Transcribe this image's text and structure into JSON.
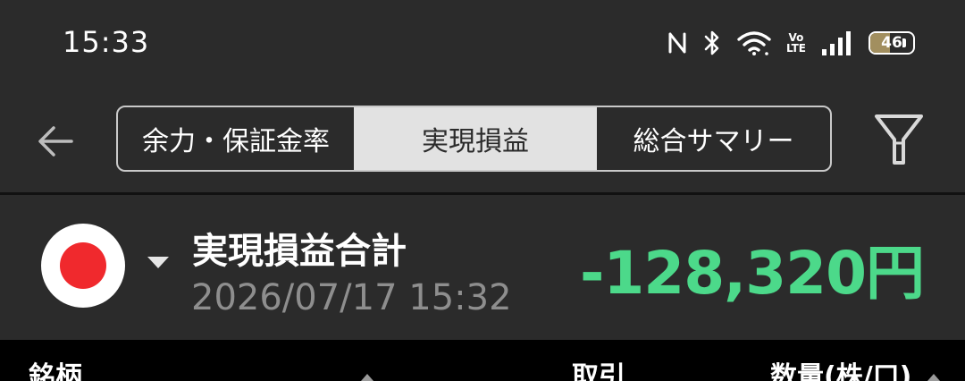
{
  "status_bar": {
    "time": "15:33",
    "icons": [
      "nfc-icon",
      "bluetooth-icon",
      "wifi-icon",
      "volte-icon",
      "signal-icon",
      "battery-icon"
    ],
    "volte_label_top": "Vo",
    "volte_label_bottom": "LTE",
    "battery_level": "46",
    "battery_fraction": 0.46
  },
  "header": {
    "back_icon": "arrow-left-icon",
    "tabs": [
      {
        "label": "余力・保証金率",
        "selected": false
      },
      {
        "label": "実現損益",
        "selected": true
      },
      {
        "label": "総合サマリー",
        "selected": false
      }
    ],
    "filter_icon": "filter-icon"
  },
  "summary": {
    "flag_icon": "japan-flag-icon",
    "title": "実現損益合計",
    "datetime": "2026/07/17  15:32",
    "value": "-128,320円",
    "value_color": "#4cd98a"
  },
  "table_header": {
    "columns": [
      "銘柄",
      "取引",
      "数量(株/口)"
    ]
  },
  "colors": {
    "background": "#2b2b2b",
    "selected_tab": "#e2e2e2",
    "flag_red": "#f0292d"
  }
}
